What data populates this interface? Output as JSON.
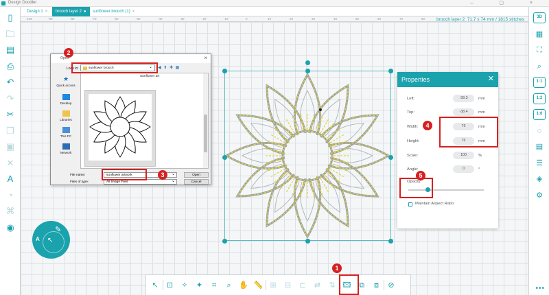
{
  "app": {
    "title": "Design Doodler"
  },
  "tabs": [
    {
      "label": "Design 1",
      "close": "×"
    },
    {
      "label": "brooch layer 2",
      "close": "●"
    },
    {
      "label": "sunflower brooch (1)",
      "close": "×"
    }
  ],
  "ruler": [
    "-100",
    "-90",
    "-80",
    "-70",
    "-60",
    "-50",
    "-40",
    "-30",
    "-20",
    "-10",
    "0",
    "10",
    "20",
    "30",
    "40",
    "50",
    "60",
    "70",
    "80"
  ],
  "status": {
    "line1": "brooch layer 2",
    "line2": "71.7 x 74 mm / 1815 stitches"
  },
  "left_icons": [
    "new-file-icon",
    "open-folder-icon",
    "save-icon",
    "print-icon",
    "undo-icon",
    "redo-icon",
    "cut-icon",
    "copy-icon",
    "paste-icon",
    "delete-icon",
    "text-icon",
    "shapes-icon",
    "monogram-icon",
    "applique-icon"
  ],
  "right_icons": [
    "3d-view-icon",
    "grid-icon",
    "fit-icon",
    "zoom-icon",
    "zoom-1-1-icon",
    "zoom-1-2-icon",
    "zoom-1-6-icon",
    "hoop-icon",
    "layers-icon",
    "list-icon",
    "stack-icon",
    "settings-icon"
  ],
  "right_labels": {
    "three_d": "3D",
    "zoom_a": "1:1",
    "zoom_b": "1:2",
    "zoom_c": "1:6"
  },
  "file_dialog": {
    "title": "Open",
    "look_in_label": "Look in:",
    "look_in_value": "sunflower brooch",
    "places": [
      "Quick access",
      "Desktop",
      "Libraries",
      "This PC",
      "Network"
    ],
    "folder_label": "Sunflower art",
    "thumbnail_label": "sunflower artwork",
    "file_name_label": "File name:",
    "file_name_value": "sunflower artwork",
    "file_type_label": "Files of type:",
    "file_type_value": "All Image Files",
    "open_button": "Open",
    "cancel_button": "Cancel"
  },
  "properties": {
    "title": "Properties",
    "left": {
      "label": "Left:",
      "value": "-39.3",
      "unit": "mm"
    },
    "top": {
      "label": "Top:",
      "value": "-38.4",
      "unit": "mm"
    },
    "width": {
      "label": "Width:",
      "value": "76",
      "unit": "mm"
    },
    "height": {
      "label": "Height:",
      "value": "76",
      "unit": "mm"
    },
    "scale": {
      "label": "Scale:",
      "value": "100",
      "unit": "%"
    },
    "angle": {
      "label": "Angle:",
      "value": "0",
      "unit": "°"
    },
    "opacity": {
      "label": "Opacity:",
      "level": 0.25
    },
    "aspect": {
      "label": "Maintain Aspect Ratio",
      "checked": false
    }
  },
  "bottom_icons": [
    "select-icon",
    "transform-icon",
    "reshape-icon",
    "node-icon",
    "crop-icon",
    "zoom-icon",
    "pan-icon",
    "measure-icon",
    "align-icon",
    "distribute-icon",
    "group-icon",
    "mirror-icon",
    "flip-icon",
    "import-image-icon",
    "trace-icon",
    "image-edit-icon",
    "clear-icon"
  ],
  "callouts": [
    "1",
    "2",
    "3",
    "4",
    "5"
  ],
  "colors": {
    "accent": "#1aa2ad",
    "callout": "#d62020",
    "thread": "#e5d23a"
  }
}
